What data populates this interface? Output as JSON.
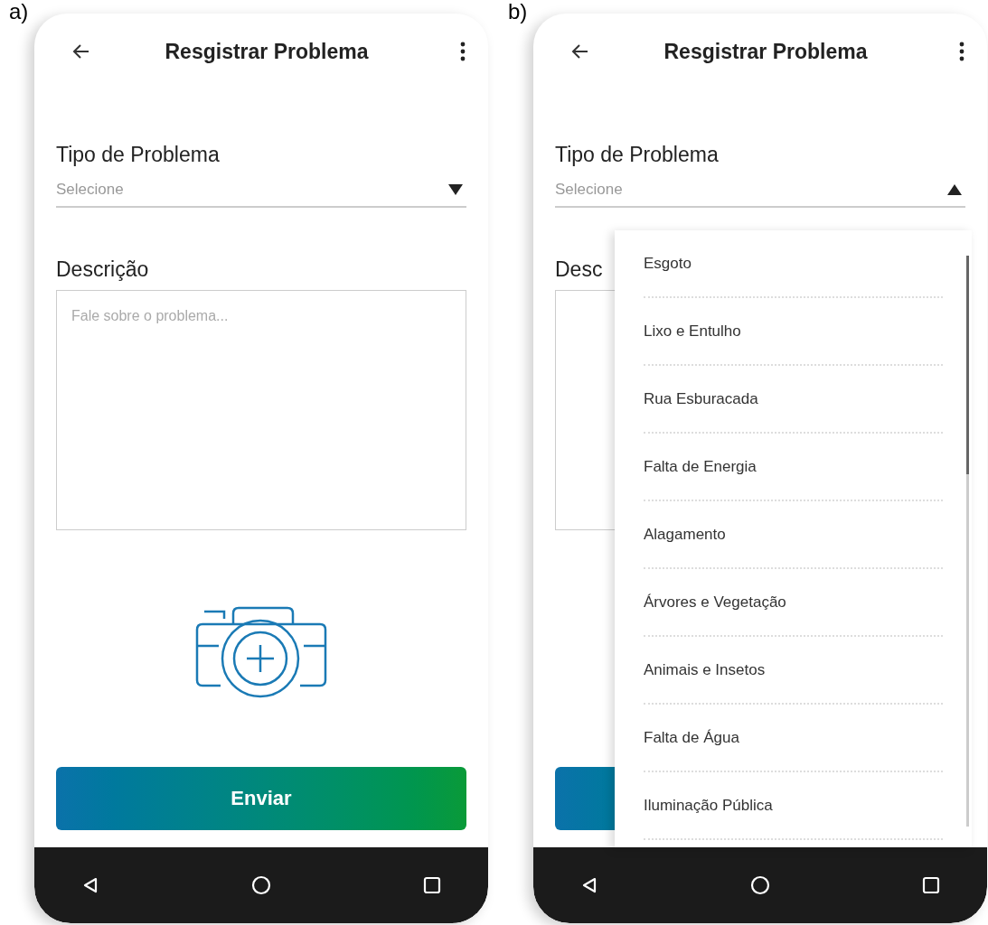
{
  "panels": [
    {
      "label": "a)",
      "screen": {
        "title": "Resgistrar Problema",
        "field_label": "Tipo de Problema",
        "select": {
          "placeholder": "Selecione",
          "expanded": false
        },
        "description_label": "Descrição",
        "textarea": {
          "placeholder": "Fale sobre o problema..."
        },
        "camera": true,
        "submit": {
          "kind": "gradient",
          "label": "Enviar"
        }
      }
    },
    {
      "label": "b)",
      "screen": {
        "title": "Resgistrar Problema",
        "field_label": "Tipo de Problema",
        "select": {
          "placeholder": "Selecione",
          "expanded": true
        },
        "description_label": "Desc",
        "camera": false,
        "submit": {
          "kind": "gradient"
        },
        "options": [
          "Esgoto",
          "Lixo e Entulho",
          "Rua Esburacada",
          "Falta de Energia",
          "Alagamento",
          "Árvores e Vegetação",
          "Animais e Insetos",
          "Falta de Água",
          "Iluminação Pública"
        ]
      }
    }
  ]
}
